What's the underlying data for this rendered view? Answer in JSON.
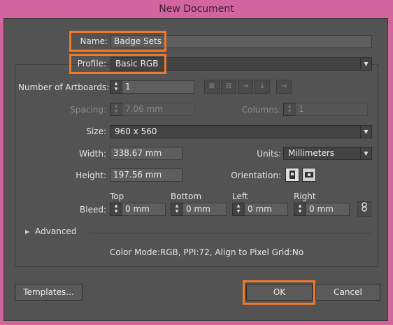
{
  "window": {
    "title": "New Document"
  },
  "form": {
    "name_label": "Name:",
    "name_value": "Badge Sets",
    "profile_label": "Profile:",
    "profile_value": "Basic RGB",
    "artboards_label": "Number of Artboards:",
    "artboards_value": "1",
    "spacing_label": "Spacing:",
    "spacing_value": "7.06 mm",
    "columns_label": "Columns:",
    "columns_value": "1",
    "size_label": "Size:",
    "size_value": "960 x 560",
    "width_label": "Width:",
    "width_value": "338.67 mm",
    "units_label": "Units:",
    "units_value": "Millimeters",
    "height_label": "Height:",
    "height_value": "197.56 mm",
    "orientation_label": "Orientation:",
    "bleed_label": "Bleed:",
    "bleed": {
      "top_label": "Top",
      "top_value": "0 mm",
      "bottom_label": "Bottom",
      "bottom_value": "0 mm",
      "left_label": "Left",
      "left_value": "0 mm",
      "right_label": "Right",
      "right_value": "0 mm"
    },
    "advanced_label": "Advanced",
    "summary": "Color Mode:RGB, PPI:72, Align to Pixel Grid:No"
  },
  "buttons": {
    "templates": "Templates...",
    "ok": "OK",
    "cancel": "Cancel"
  },
  "colors": {
    "highlight": "#f0782a",
    "dialog_bg": "#535353",
    "window_frame": "#d2649e"
  }
}
